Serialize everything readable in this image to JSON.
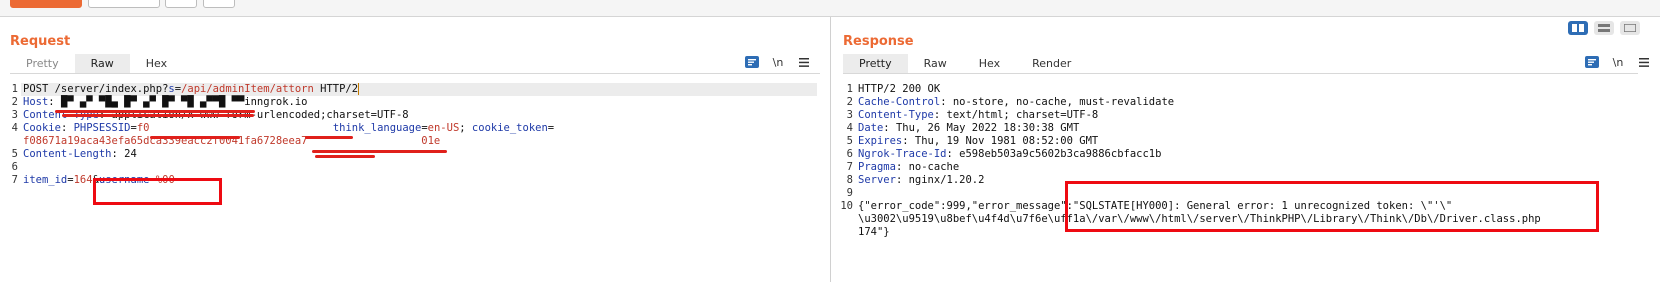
{
  "request": {
    "title": "Request",
    "tabs": [
      "Pretty",
      "Raw",
      "Hex"
    ],
    "active_tab": "Raw",
    "newline_icon_label": "\\n",
    "lines": [
      {
        "n": "1",
        "parts": [
          {
            "t": "POST /server/index.php?",
            "c": "v"
          },
          {
            "t": "s",
            "c": "pk"
          },
          {
            "t": "=",
            "c": "v"
          },
          {
            "t": "/api/adminItem/attorn",
            "c": "pv"
          },
          {
            "t": " HTTP/2",
            "c": "v"
          }
        ]
      },
      {
        "n": "2",
        "parts": [
          {
            "t": "Host",
            "c": "k"
          },
          {
            "t": ": ",
            "c": "v"
          },
          {
            "t": "█▀ ▄▀ ▀█▄ █▀ ▄▀ █▀ ▀█ ▄▀▀█ ▀▀",
            "c": "v"
          },
          {
            "t": "inngrok.io",
            "c": "v"
          }
        ]
      },
      {
        "n": "3",
        "parts": [
          {
            "t": "Content-Type",
            "c": "k"
          },
          {
            "t": ": application/x-www-form-urlencoded;charset=UTF-8",
            "c": "v"
          }
        ]
      },
      {
        "n": "4",
        "parts": [
          {
            "t": "Cookie",
            "c": "k"
          },
          {
            "t": ": ",
            "c": "v"
          },
          {
            "t": "PHPSESSID",
            "c": "k"
          },
          {
            "t": "=",
            "c": "v"
          },
          {
            "t": "f0",
            "c": "pv"
          },
          {
            "t": "                             ",
            "c": "v"
          },
          {
            "t": "think_language",
            "c": "k"
          },
          {
            "t": "=",
            "c": "v"
          },
          {
            "t": "en-US",
            "c": "pv"
          },
          {
            "t": "; ",
            "c": "v"
          },
          {
            "t": "cookie_token",
            "c": "k"
          },
          {
            "t": "=",
            "c": "v"
          }
        ]
      },
      {
        "n": "",
        "parts": [
          {
            "t": "f08671a19aca43efa65dca339eacc2f0041fa6728eea",
            "c": "pv"
          },
          {
            "t": "7",
            "c": "pv"
          },
          {
            "t": "                  ",
            "c": "v"
          },
          {
            "t": "01e",
            "c": "pv"
          }
        ]
      },
      {
        "n": "5",
        "parts": [
          {
            "t": "Content-Length",
            "c": "k"
          },
          {
            "t": ": 24",
            "c": "v"
          }
        ]
      },
      {
        "n": "6",
        "parts": []
      },
      {
        "n": "7",
        "parts": [
          {
            "t": "item_id",
            "c": "k"
          },
          {
            "t": "=",
            "c": "v"
          },
          {
            "t": "164",
            "c": "pv"
          },
          {
            "t": "&",
            "c": "v"
          },
          {
            "t": "username",
            "c": "k"
          },
          {
            "t": "=",
            "c": "v"
          },
          {
            "t": "%00",
            "c": "pv"
          }
        ]
      }
    ]
  },
  "response": {
    "title": "Response",
    "tabs": [
      "Pretty",
      "Raw",
      "Hex",
      "Render"
    ],
    "active_tab": "Pretty",
    "newline_icon_label": "\\n",
    "lines": [
      {
        "n": "1",
        "parts": [
          {
            "t": "HTTP/2 200 OK",
            "c": "v"
          }
        ]
      },
      {
        "n": "2",
        "parts": [
          {
            "t": "Cache-Control",
            "c": "k"
          },
          {
            "t": ": no-store, no-cache, must-revalidate",
            "c": "v"
          }
        ]
      },
      {
        "n": "3",
        "parts": [
          {
            "t": "Content-Type",
            "c": "k"
          },
          {
            "t": ": text/html; charset=UTF-8",
            "c": "v"
          }
        ]
      },
      {
        "n": "4",
        "parts": [
          {
            "t": "Date",
            "c": "k"
          },
          {
            "t": ": Thu, 26 May 2022 18:30:38 GMT",
            "c": "v"
          }
        ]
      },
      {
        "n": "5",
        "parts": [
          {
            "t": "Expires",
            "c": "k"
          },
          {
            "t": ": Thu, 19 Nov 1981 08:52:00 GMT",
            "c": "v"
          }
        ]
      },
      {
        "n": "6",
        "parts": [
          {
            "t": "Ngrok-Trace-Id",
            "c": "k"
          },
          {
            "t": ": e598eb503a9c5602b3ca9886cbfacc1b",
            "c": "v"
          }
        ]
      },
      {
        "n": "7",
        "parts": [
          {
            "t": "Pragma",
            "c": "k"
          },
          {
            "t": ": no-cache",
            "c": "v"
          }
        ]
      },
      {
        "n": "8",
        "parts": [
          {
            "t": "Server",
            "c": "k"
          },
          {
            "t": ": nginx/1.20.2",
            "c": "v"
          }
        ]
      },
      {
        "n": "9",
        "parts": []
      },
      {
        "n": "10",
        "parts": [
          {
            "t": "{\"error_code\":999,\"error_message\":\"SQLSTATE[HY000]: General error: 1 unrecognized token: \\\"'\\\"",
            "c": "v"
          }
        ]
      },
      {
        "n": "",
        "parts": [
          {
            "t": "\\u3002\\u9519\\u8bef\\u4f4d\\u7f6e\\uff1a\\/var\\/www\\/html\\/server\\/ThinkPHP\\/Library\\/Think\\/Db\\/Driver.class.php",
            "c": "v"
          }
        ]
      },
      {
        "n": "",
        "parts": [
          {
            "t": "174\"}",
            "c": "v"
          }
        ]
      }
    ]
  },
  "toolbar": {
    "right_text": "▾ ▮ ? ⁄⁄"
  },
  "colors": {
    "accent": "#ec6a34",
    "highlight_box": "#ee0a12",
    "redaction": "#e0201b",
    "header_name": "#1f3aa8",
    "param_value": "#c0392b",
    "toggle_active": "#2e6db5"
  }
}
